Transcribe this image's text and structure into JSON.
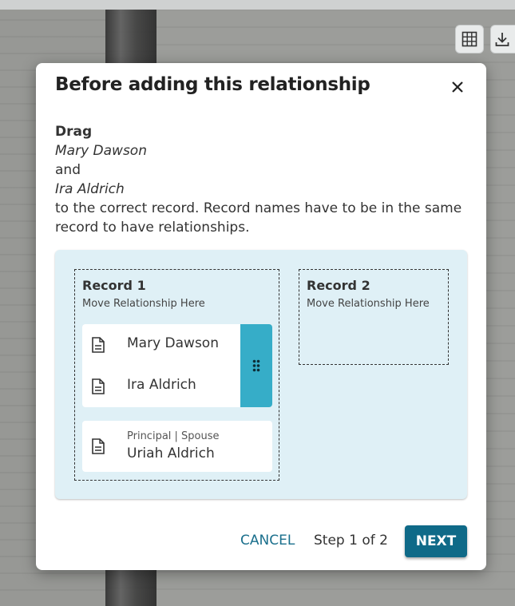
{
  "modal": {
    "title": "Before adding this relationship",
    "instructions": {
      "verb": "Drag",
      "name1": "Mary Dawson",
      "conjunction": "and",
      "name2": "Ira Aldrich",
      "line1": "to the correct record. Record names have to be in the same",
      "line2": "record to have relationships."
    },
    "records": [
      {
        "title": "Record 1",
        "subtitle": "Move Relationship Here",
        "group": [
          {
            "name": "Mary Dawson",
            "icon": "document-icon"
          },
          {
            "name": "Ira Aldrich",
            "icon": "document-icon"
          }
        ],
        "single": {
          "role": "Principal | Spouse",
          "name": "Uriah Aldrich",
          "icon": "document-icon"
        }
      },
      {
        "title": "Record 2",
        "subtitle": "Move Relationship Here"
      }
    ],
    "footer": {
      "cancel_label": "CANCEL",
      "step_label": "Step 1 of 2",
      "next_label": "NEXT"
    }
  },
  "toolbar": {
    "icons": [
      "grid-icon",
      "download-icon"
    ]
  },
  "colors": {
    "accent": "#0f6a88",
    "panel": "#dff0f6",
    "handle": "#36adc8",
    "link": "#1a6f8c"
  }
}
